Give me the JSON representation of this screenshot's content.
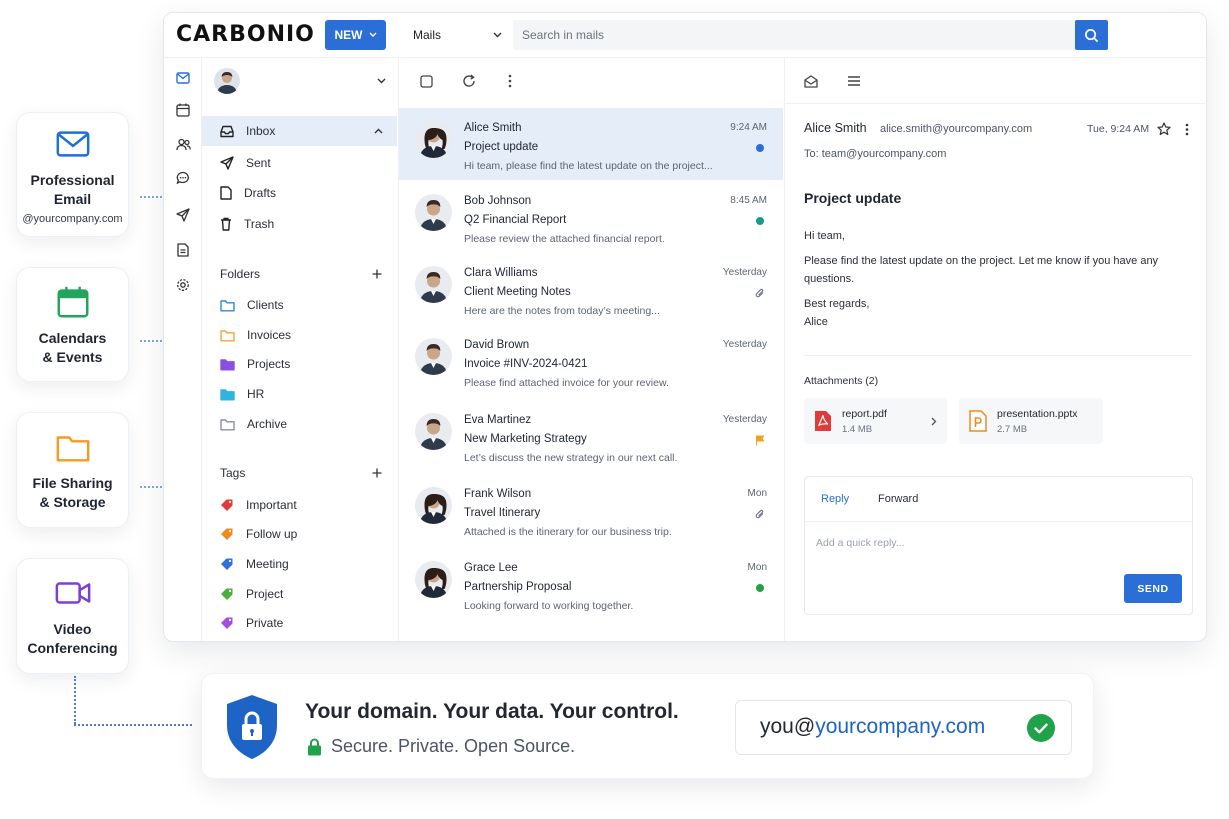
{
  "features": [
    {
      "title": "Professional\nEmail",
      "sub": "@yourcompany.com",
      "icon": "envelope-icon",
      "color": "#1e6fd9"
    },
    {
      "title": "Calendars\n& Events",
      "sub": "",
      "icon": "calendar-icon",
      "color": "#22a55b"
    },
    {
      "title": "File Sharing\n& Storage",
      "sub": "",
      "icon": "folder-icon",
      "color": "#f39c1f"
    },
    {
      "title": "Video\nConferencing",
      "sub": "",
      "icon": "video-camera-icon",
      "color": "#7b3fd6"
    }
  ],
  "topbar": {
    "logo": "CARBONIO",
    "new_label": "NEW",
    "mails_label": "Mails",
    "search_placeholder": "Search in mails"
  },
  "rail": [
    "mail-icon",
    "calendar-icon",
    "contacts-icon",
    "chat-icon",
    "send-icon",
    "files-icon",
    "settings-icon"
  ],
  "nav": {
    "inbox": "Inbox",
    "sent": "Sent",
    "drafts": "Drafts",
    "trash": "Trash",
    "folders_heading": "Folders",
    "folders": [
      {
        "label": "Clients",
        "color": "#2f86e0"
      },
      {
        "label": "Invoices",
        "color": "#f5a23a"
      },
      {
        "label": "Projects",
        "color": "#8a4fe0"
      },
      {
        "label": "HR",
        "color": "#2fb4e0"
      },
      {
        "label": "Archive",
        "color": "#8a8f98"
      }
    ],
    "tags_heading": "Tags",
    "tags": [
      {
        "label": "Important",
        "color": "#e03b3b"
      },
      {
        "label": "Follow up",
        "color": "#f08a1f"
      },
      {
        "label": "Meeting",
        "color": "#2f6fe0"
      },
      {
        "label": "Project",
        "color": "#4caf3d"
      },
      {
        "label": "Private",
        "color": "#a24fe0"
      }
    ]
  },
  "messages": [
    {
      "sender": "Alice Smith",
      "subject": "Project update",
      "preview": "Hi team, please find the latest update on the project...",
      "time": "9:24 AM",
      "mark": "dot",
      "mark_color": "#2b6fd6",
      "avatar": "female"
    },
    {
      "sender": "Bob Johnson",
      "subject": "Q2 Financial Report",
      "preview": "Please review the attached financial report.",
      "time": "8:45 AM",
      "mark": "dot",
      "mark_color": "#1a9a8a",
      "avatar": "male"
    },
    {
      "sender": "Clara Williams",
      "subject": "Client Meeting Notes",
      "preview": "Here are the notes from today’s meeting...",
      "time": "Yesterday",
      "mark": "paperclip",
      "mark_color": "#6b7280",
      "avatar": "male"
    },
    {
      "sender": "David Brown",
      "subject": "Invoice #INV-2024-0421",
      "preview": "Please find attached invoice for your review.",
      "time": "Yesterday",
      "mark": "none",
      "mark_color": "",
      "avatar": "male"
    },
    {
      "sender": "Eva Martinez",
      "subject": "New Marketing Strategy",
      "preview": "Let’s discuss the new strategy in our next call.",
      "time": "Yesterday",
      "mark": "flag",
      "mark_color": "#f0a01f",
      "avatar": "male"
    },
    {
      "sender": "Frank Wilson",
      "subject": "Travel Itinerary",
      "preview": "Attached is the itinerary for our business trip.",
      "time": "Mon",
      "mark": "paperclip",
      "mark_color": "#6b7280",
      "avatar": "female"
    },
    {
      "sender": "Grace Lee",
      "subject": "Partnership Proposal",
      "preview": "Looking forward to working together.",
      "time": "Mon",
      "mark": "dot",
      "mark_color": "#1fa24a",
      "avatar": "female"
    }
  ],
  "reader": {
    "from_name": "Alice Smith",
    "from_email": "alice.smith@yourcompany.com",
    "date": "Tue, 9:24 AM",
    "to": "To:  team@yourcompany.com",
    "subject": "Project update",
    "body": [
      "Hi team,",
      "Please find the latest update on the project. Let me know if you have any questions.",
      "Best regards,",
      "Alice"
    ],
    "attachments_heading": "Attachments (2)",
    "attachments": [
      {
        "name": "report.pdf",
        "size": "1.4 MB",
        "color": "#e03b3b"
      },
      {
        "name": "presentation.pptx",
        "size": "2.7 MB",
        "color": "#f08a1f"
      }
    ],
    "reply_tab": "Reply",
    "forward_tab": "Forward",
    "reply_placeholder": "Add a quick reply...",
    "send_label": "SEND"
  },
  "banner": {
    "title": "Your domain. Your data. Your control.",
    "subtitle": "Secure. Private. Open Source.",
    "domain_prefix": "you@",
    "domain_accent": "yourcompany.com"
  }
}
